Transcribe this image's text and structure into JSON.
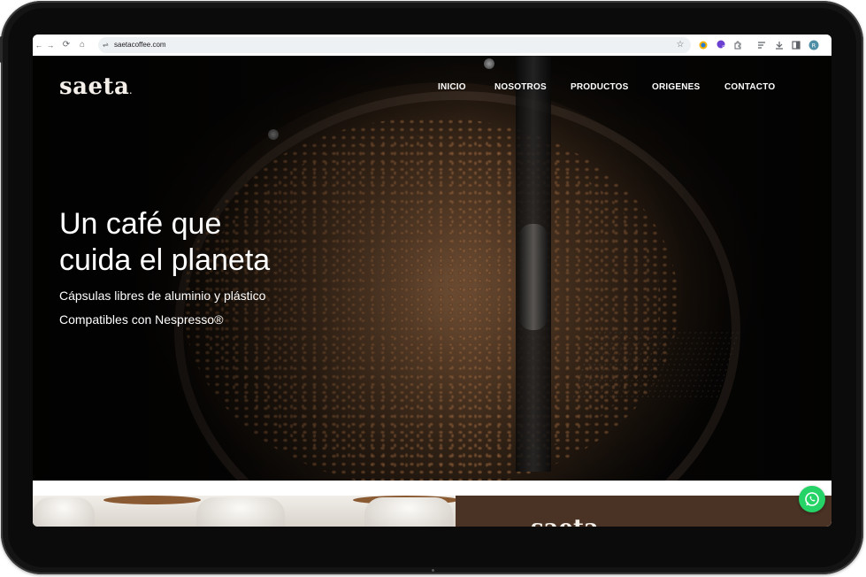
{
  "browser": {
    "url": "saetacoffee.com",
    "icons": {
      "back": "←",
      "forward": "→",
      "reload": "⟳",
      "home": "⌂",
      "site_info": "⇌",
      "bookmark": "☆",
      "profile_initial": "R",
      "extension_badge": "5"
    }
  },
  "site": {
    "logo": "saeta",
    "nav": [
      "INICIO",
      "NOSOTROS",
      "PRODUCTOS",
      "ORIGENES",
      "CONTACTO"
    ],
    "hero": {
      "title_line1": "Un café que",
      "title_line2": "cuida el planeta",
      "subtitle1": "Cápsulas libres de aluminio y plástico",
      "subtitle2": "Compatibles con Nespresso®"
    },
    "lower_logo": "saeta",
    "whatsapp_icon": "whatsapp-icon"
  },
  "colors": {
    "brown_panel": "#4a3224",
    "whatsapp": "#25d366",
    "text_light": "#ffffff"
  }
}
